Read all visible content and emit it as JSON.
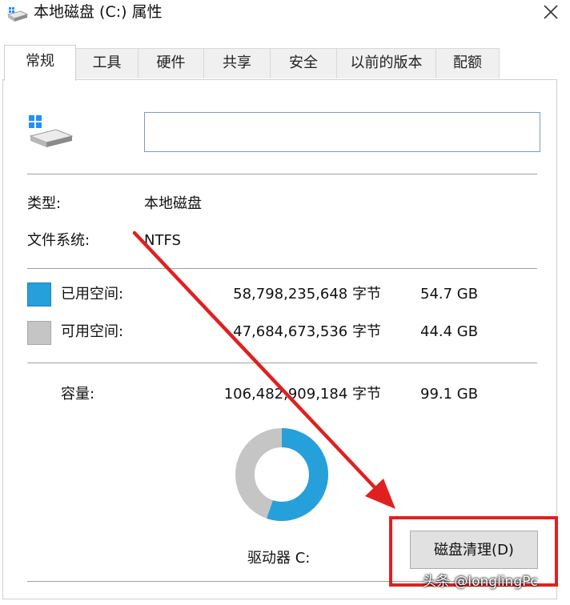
{
  "window": {
    "title": "本地磁盘 (C:) 属性",
    "close_glyph": "✕"
  },
  "tabs": [
    {
      "label": "常规",
      "active": true
    },
    {
      "label": "工具",
      "active": false
    },
    {
      "label": "硬件",
      "active": false
    },
    {
      "label": "共享",
      "active": false
    },
    {
      "label": "安全",
      "active": false
    },
    {
      "label": "以前的版本",
      "active": false
    },
    {
      "label": "配额",
      "active": false
    }
  ],
  "general": {
    "drive_name_value": "",
    "type_label": "类型:",
    "type_value": "本地磁盘",
    "fs_label": "文件系统:",
    "fs_value": "NTFS",
    "used": {
      "label": "已用空间:",
      "bytes": "58,798,235,648 字节",
      "size": "54.7 GB",
      "color": "#26a0da"
    },
    "free": {
      "label": "可用空间:",
      "bytes": "47,684,673,536 字节",
      "size": "44.4 GB",
      "color": "#c5c5c5"
    },
    "capacity": {
      "label": "容量:",
      "bytes": "106,482,909,184 字节",
      "size": "99.1 GB"
    },
    "used_fraction": 0.552,
    "drive_label": "驱动器 C:",
    "cleanup_button": "磁盘清理(D)"
  },
  "annotation": {
    "arrow_color": "#e02020",
    "highlight_color": "#e02020"
  },
  "watermark": "头条 @longlingPc"
}
